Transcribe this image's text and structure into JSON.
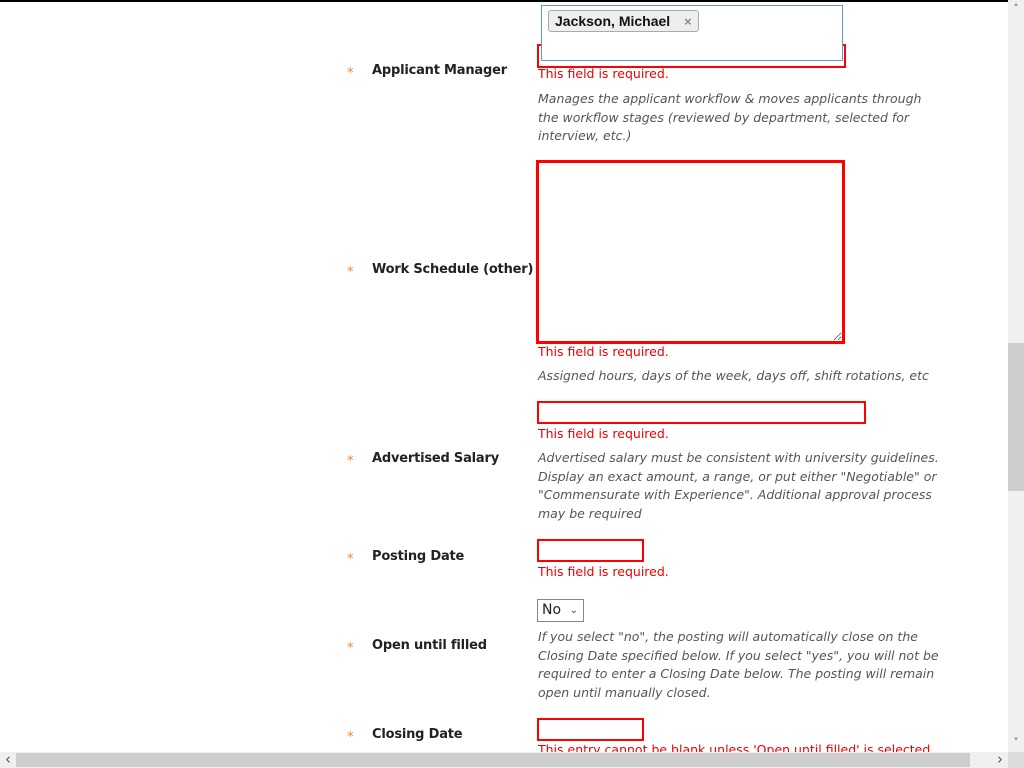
{
  "applicant_manager": {
    "label": "Applicant Manager",
    "required_mark": "*",
    "selected": [
      {
        "name": "Jackson, Michael",
        "remove_icon": "×"
      }
    ],
    "error": "This field is required.",
    "help": "Manages the applicant workflow & moves applicants through the workflow stages (reviewed by department, selected for interview, etc.)"
  },
  "work_schedule": {
    "label": "Work Schedule (other)",
    "required_mark": "*",
    "value": "",
    "error": "This field is required.",
    "help": "Assigned hours, days of the week, days off, shift rotations, etc"
  },
  "advertised_salary": {
    "label": "Advertised Salary",
    "required_mark": "*",
    "value": "",
    "error": "This field is required.",
    "help": "Advertised salary must be consistent with university guidelines. Display an exact amount, a range, or put either \"Negotiable\" or \"Commensurate with Experience\". Additional approval process may be required"
  },
  "posting_date": {
    "label": "Posting Date",
    "required_mark": "*",
    "value": "",
    "error": "This field is required."
  },
  "open_until_filled": {
    "label": "Open until filled",
    "required_mark": "*",
    "selected": "No",
    "chevron": "⌄",
    "help": "If you select \"no\", the posting will automatically close on the Closing Date specified below. If you select \"yes\", you will not be required to enter a Closing Date below. The posting will remain open until manually closed."
  },
  "closing_date": {
    "label": "Closing Date",
    "required_mark": "*",
    "value": "",
    "error": "This entry cannot be blank unless 'Open until filled' is selected."
  },
  "scrollbars": {
    "up": "˄",
    "down": "˅",
    "left": "‹",
    "right": "›"
  },
  "colors": {
    "error": "#ff0000",
    "required": "#f08a24",
    "focus": "#5b9dd9"
  }
}
